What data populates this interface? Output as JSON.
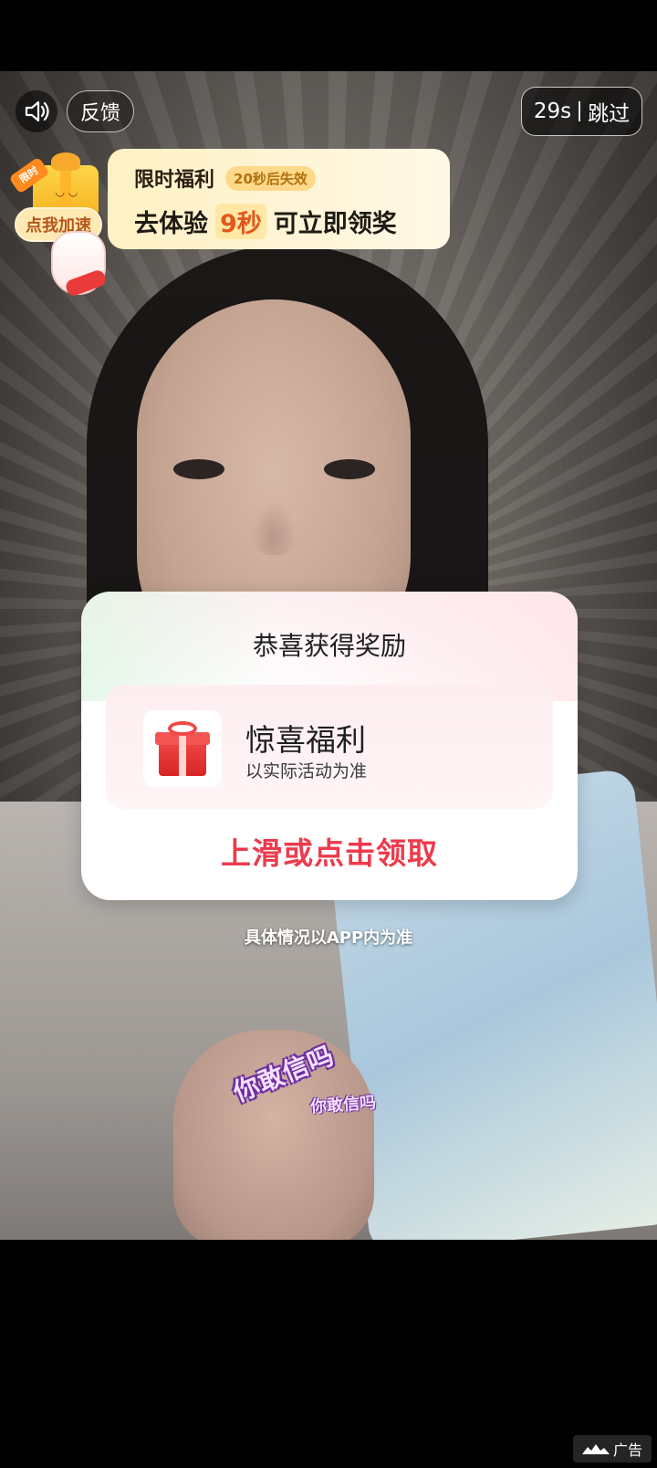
{
  "top_bar": {
    "feedback_label": "反馈",
    "skip_countdown": "29s",
    "skip_label": "跳过",
    "sound_icon": "speaker-icon"
  },
  "promo": {
    "limited_tag": "限时",
    "speed_up_label": "点我加速",
    "title": "限时福利",
    "badge": "20秒后失效",
    "prefix": "去体验",
    "seconds": "9秒",
    "suffix": "可立即领奖"
  },
  "video": {
    "sticker_main": "你敢信吗",
    "sticker_small": "你敢信吗"
  },
  "reward_card": {
    "title": "恭喜获得奖励",
    "reward_name": "惊喜福利",
    "reward_sub": "以实际活动为准",
    "claim_label": "上滑或点击领取",
    "gift_icon": "gift-icon"
  },
  "disclaimer": "具体情况以APP内为准",
  "ad_label": "广告",
  "colors": {
    "claim": "#ee3a4d",
    "promo_bg": "#fff1c4",
    "promo_seconds": "#e2571b"
  }
}
